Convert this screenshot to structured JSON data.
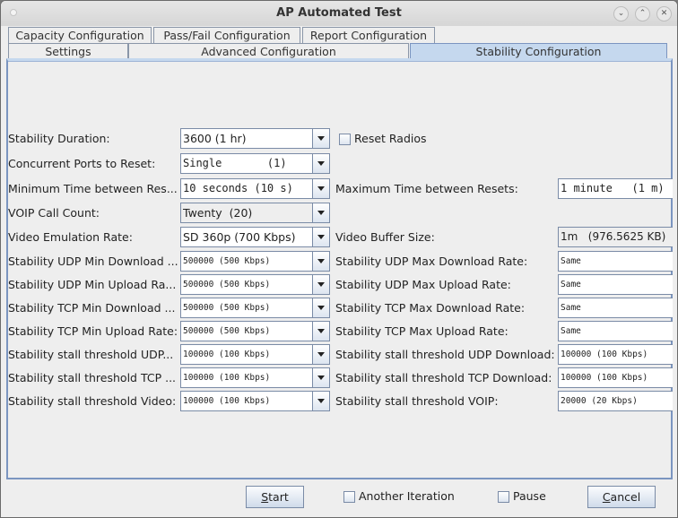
{
  "window": {
    "title": "AP Automated Test",
    "controls": [
      "minimize-icon",
      "maximize-icon",
      "close-icon"
    ]
  },
  "tabs": {
    "row1": [
      {
        "label": "Capacity Configuration"
      },
      {
        "label": "Pass/Fail Configuration"
      },
      {
        "label": "Report Configuration"
      }
    ],
    "row2": [
      {
        "label": "Settings"
      },
      {
        "label": "Advanced Configuration"
      },
      {
        "label": "Stability Configuration",
        "active": true
      }
    ]
  },
  "form": {
    "stability_duration": {
      "label": "Stability Duration:",
      "value": "3600 (1 hr)"
    },
    "reset_radios": {
      "label": "Reset Radios",
      "checked": false
    },
    "concurrent_ports": {
      "label": "Concurrent Ports to Reset:",
      "value": "Single       (1)"
    },
    "min_time_resets": {
      "label": "Minimum Time between Res...",
      "value": "10 seconds (10 s)"
    },
    "max_time_resets": {
      "label": "Maximum Time between Resets:",
      "value": "1 minute   (1 m)"
    },
    "voip_call_count": {
      "label": "VOIP Call Count:",
      "value": "Twenty  (20)"
    },
    "video_emulation_rate": {
      "label": "Video Emulation Rate:",
      "value": "SD 360p (700 Kbps)"
    },
    "video_buffer_size": {
      "label": "Video Buffer Size:",
      "value": "1m   (976.5625 KB)"
    },
    "udp_min_download": {
      "label": "Stability UDP Min Download ...",
      "value": "500000 (500 Kbps)"
    },
    "udp_max_download": {
      "label": "Stability UDP Max Download Rate:",
      "value": "Same"
    },
    "udp_min_upload": {
      "label": "Stability UDP Min Upload Ra...",
      "value": "500000 (500 Kbps)"
    },
    "udp_max_upload": {
      "label": "Stability UDP Max Upload Rate:",
      "value": "Same"
    },
    "tcp_min_download": {
      "label": "Stability TCP Min Download ...",
      "value": "500000 (500 Kbps)"
    },
    "tcp_max_download": {
      "label": "Stability TCP Max Download Rate:",
      "value": "Same"
    },
    "tcp_min_upload": {
      "label": "Stability TCP Min Upload Rate:",
      "value": "500000 (500 Kbps)"
    },
    "tcp_max_upload": {
      "label": "Stability TCP Max Upload Rate:",
      "value": "Same"
    },
    "stall_udp_upload": {
      "label": "Stability stall threshold UDP...",
      "value": "100000 (100 Kbps)"
    },
    "stall_udp_download": {
      "label": "Stability stall threshold UDP Download:",
      "value": "100000 (100 Kbps)"
    },
    "stall_tcp_upload": {
      "label": "Stability stall threshold TCP ...",
      "value": "100000 (100 Kbps)"
    },
    "stall_tcp_download": {
      "label": "Stability stall threshold TCP Download:",
      "value": "100000 (100 Kbps)"
    },
    "stall_video": {
      "label": "Stability stall threshold Video:",
      "value": "100000 (100 Kbps)"
    },
    "stall_voip": {
      "label": "Stability stall threshold VOIP:",
      "value": "20000 (20 Kbps)"
    }
  },
  "footer": {
    "start": {
      "mnemonic": "S",
      "rest": "tart"
    },
    "another_iteration": {
      "label": "Another Iteration",
      "checked": false
    },
    "pause": {
      "label": "Pause",
      "checked": false
    },
    "cancel": {
      "mnemonic": "C",
      "rest": "ancel"
    }
  }
}
